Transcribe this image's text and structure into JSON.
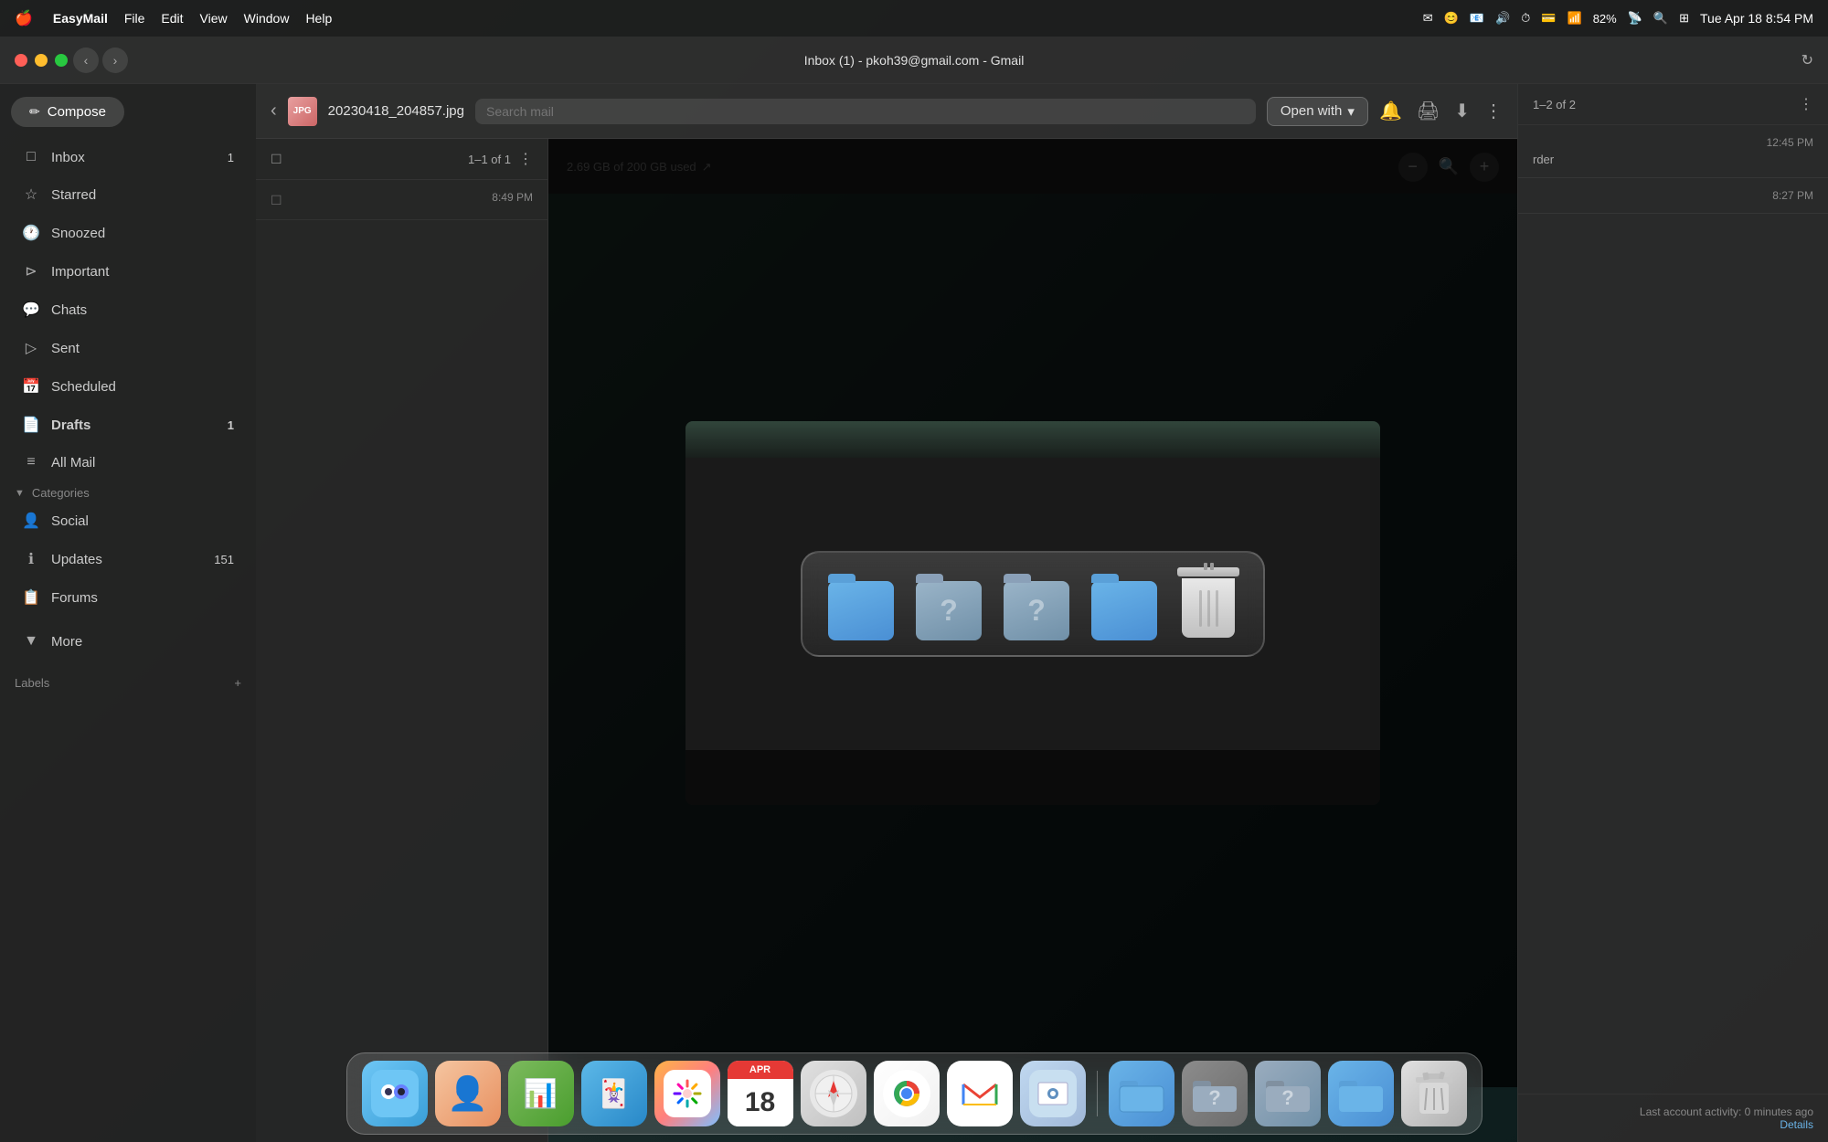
{
  "menubar": {
    "apple": "⌘",
    "app_name": "EasyMail",
    "menus": [
      "File",
      "Edit",
      "View",
      "Window",
      "Help"
    ],
    "right_icons": [
      "mail",
      "face",
      "mail2",
      "volume",
      "timer",
      "creditcard",
      "wifi_bar",
      "battery",
      "wifi",
      "control"
    ],
    "battery": "82%",
    "datetime": "Tue Apr 18  8:54 PM"
  },
  "titlebar": {
    "title": "Inbox (1) - pkoh39@gmail.com - Gmail"
  },
  "viewer_toolbar": {
    "filename": "20230418_204857.jpg",
    "search_placeholder": "Search mail",
    "open_with": "Open with"
  },
  "sidebar": {
    "compose_label": "Compose",
    "items": [
      {
        "id": "inbox",
        "label": "Inbox",
        "icon": "inbox",
        "badge": "1"
      },
      {
        "id": "starred",
        "label": "Starred",
        "icon": "star",
        "badge": ""
      },
      {
        "id": "snoozed",
        "label": "Snoozed",
        "icon": "clock",
        "badge": ""
      },
      {
        "id": "important",
        "label": "Important",
        "icon": "tag",
        "badge": ""
      },
      {
        "id": "chats",
        "label": "Chats",
        "icon": "chat",
        "badge": ""
      },
      {
        "id": "sent",
        "label": "Sent",
        "icon": "send",
        "badge": ""
      },
      {
        "id": "scheduled",
        "label": "Scheduled",
        "icon": "schedule",
        "badge": ""
      },
      {
        "id": "drafts",
        "label": "Drafts",
        "icon": "draft",
        "badge": "1",
        "bold": true
      },
      {
        "id": "allmail",
        "label": "All Mail",
        "icon": "allmail",
        "badge": ""
      },
      {
        "id": "categories",
        "label": "Categories",
        "icon": "chevron",
        "badge": "",
        "section": true
      },
      {
        "id": "social",
        "label": "Social",
        "icon": "person",
        "badge": ""
      },
      {
        "id": "updates",
        "label": "Updates",
        "icon": "info",
        "badge": "151"
      },
      {
        "id": "forums",
        "label": "Forums",
        "icon": "forum",
        "badge": ""
      },
      {
        "id": "more",
        "label": "More",
        "icon": "chevron_down",
        "badge": ""
      }
    ],
    "labels_header": "Labels",
    "labels_add": "+"
  },
  "email_list": {
    "count_label": "1–1 of 1",
    "items": [
      {
        "sender": "",
        "subject": "",
        "time": "8:49 PM",
        "selected": true
      }
    ]
  },
  "email_detail": {
    "count": "1–2 of 2",
    "items": [
      {
        "sender": "",
        "subject": "rder",
        "time": "12:45 PM"
      },
      {
        "sender": "",
        "subject": "",
        "time": "8:27 PM",
        "count": ""
      }
    ],
    "footer_activity": "Last account activity: 0 minutes ago",
    "footer_details": "Details"
  },
  "image_viewer": {
    "storage_text": "2.69 GB of 200 GB used",
    "zoom_minus": "−",
    "zoom_plus": "+"
  },
  "dock": {
    "apps": [
      {
        "id": "finder",
        "label": "Finder",
        "icon": "🖥"
      },
      {
        "id": "contacts",
        "label": "Contacts",
        "icon": "👤"
      },
      {
        "id": "mariner",
        "label": "Mariner",
        "icon": "📊"
      },
      {
        "id": "cards",
        "label": "Cards",
        "icon": "🃏"
      },
      {
        "id": "photos",
        "label": "Photos",
        "icon": "🌸"
      },
      {
        "id": "calendar",
        "label": "Calendar",
        "month": "APR",
        "date": "18"
      },
      {
        "id": "safari",
        "label": "Safari",
        "icon": "🧭"
      },
      {
        "id": "chrome",
        "label": "Chrome",
        "icon": "⊙"
      },
      {
        "id": "gmail",
        "label": "Gmail",
        "icon": "✉"
      },
      {
        "id": "preview",
        "label": "Preview",
        "icon": "🖼"
      },
      {
        "id": "folder1",
        "label": "Folder",
        "icon": "📁"
      },
      {
        "id": "folder2",
        "label": "Folder?",
        "icon": "❓"
      },
      {
        "id": "folder3",
        "label": "Folder?",
        "icon": "❓"
      },
      {
        "id": "folder4",
        "label": "Folder",
        "icon": "📁"
      },
      {
        "id": "trash",
        "label": "Trash",
        "icon": "🗑"
      }
    ]
  }
}
